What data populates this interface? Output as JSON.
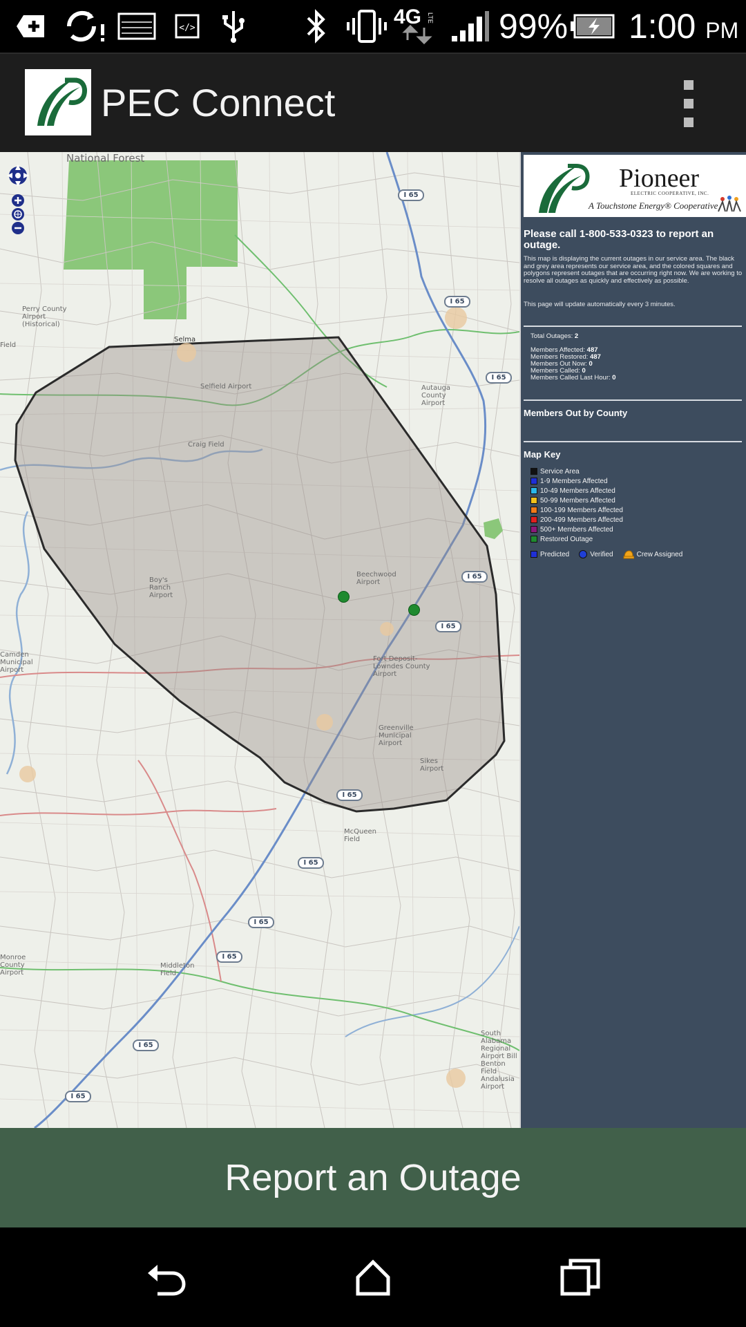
{
  "status_bar": {
    "battery_percent": "99%",
    "time": "1:00",
    "ampm": "PM",
    "network": "4G",
    "icons": [
      "add-box-icon",
      "sync-error-icon",
      "picture-icon",
      "code-icon",
      "usb-icon",
      "bluetooth-icon",
      "vibrate-icon",
      "4g-lte-icon",
      "signal-icon",
      "battery-charging-icon"
    ]
  },
  "app_bar": {
    "title": "PEC Connect",
    "logo": "pec-logo",
    "menu_icon": "overflow-menu-icon"
  },
  "map": {
    "labels": {
      "national_forest": "National Forest",
      "selma": "Selma",
      "selfield": "Selfield Airport",
      "craig_field": "Craig Field",
      "perry_county": "Perry County Airport (Historical)",
      "beechwood": "Beechwood Airport",
      "boys_ranch": "Boy's Ranch Airport",
      "fort_deposit": "Fort Deposit-Lowndes County Airport",
      "greenville": "Greenville Municipal Airport",
      "sikes": "Sikes Airport",
      "mcqueen": "McQueen Field",
      "middleton": "Middleton Field",
      "monroe": "Monroe County Airport",
      "autauga": "Autauga County Airport",
      "south_alabama": "South Alabama Regional Airport Bill Benton Field Andalusia Airport",
      "camden": "Camden Municipal Airport",
      "field": "Field"
    },
    "highway_label": "I 65",
    "controls": [
      "pan-icon",
      "zoom-in-icon",
      "zoom-world-icon",
      "zoom-out-icon"
    ]
  },
  "panel": {
    "brand_name": "Pioneer",
    "brand_sub": "ELECTRIC COOPERATIVE, INC.",
    "brand_tagline": "A Touchstone Energy® Cooperative",
    "heading": "Please call 1-800-533-0323 to report an outage.",
    "description": "This map is displaying the current outages in our service area. The black and grey area represents our service area, and the colored squares and polygons represent outages that are occurring right now. We are working to resolve all outages as quickly and effectively as possible.",
    "update_note": "This page will update automatically every 3 minutes.",
    "stats": {
      "total_outages_label": "Total Outages:",
      "total_outages": "2",
      "members_affected_label": "Members Affected:",
      "members_affected": "487",
      "members_restored_label": "Members Restored:",
      "members_restored": "487",
      "members_out_now_label": "Members Out Now:",
      "members_out_now": "0",
      "members_called_label": "Members Called:",
      "members_called": "0",
      "members_called_last_hour_label": "Members Called Last Hour:",
      "members_called_last_hour": "0"
    },
    "by_county_title": "Members Out by County",
    "map_key_title": "Map Key",
    "key_items": [
      {
        "label": "Service Area",
        "color": "#111111"
      },
      {
        "label": "1-9 Members Affected",
        "color": "#1f2fd6"
      },
      {
        "label": "10-49 Members Affected",
        "color": "#2ab7e8"
      },
      {
        "label": "50-99 Members Affected",
        "color": "#f2c21b"
      },
      {
        "label": "100-199 Members Affected",
        "color": "#f07a1a"
      },
      {
        "label": "200-499 Members Affected",
        "color": "#e02020"
      },
      {
        "label": "500+ Members Affected",
        "color": "#8a1a7a"
      },
      {
        "label": "Restored Outage",
        "color": "#1f8a2f"
      }
    ],
    "key_extra": {
      "predicted": "Predicted",
      "verified": "Verified",
      "crew_assigned": "Crew Assigned"
    }
  },
  "report_button": {
    "label": "Report an Outage"
  },
  "nav_bar": {
    "buttons": [
      "back-icon",
      "home-icon",
      "recents-icon"
    ]
  }
}
